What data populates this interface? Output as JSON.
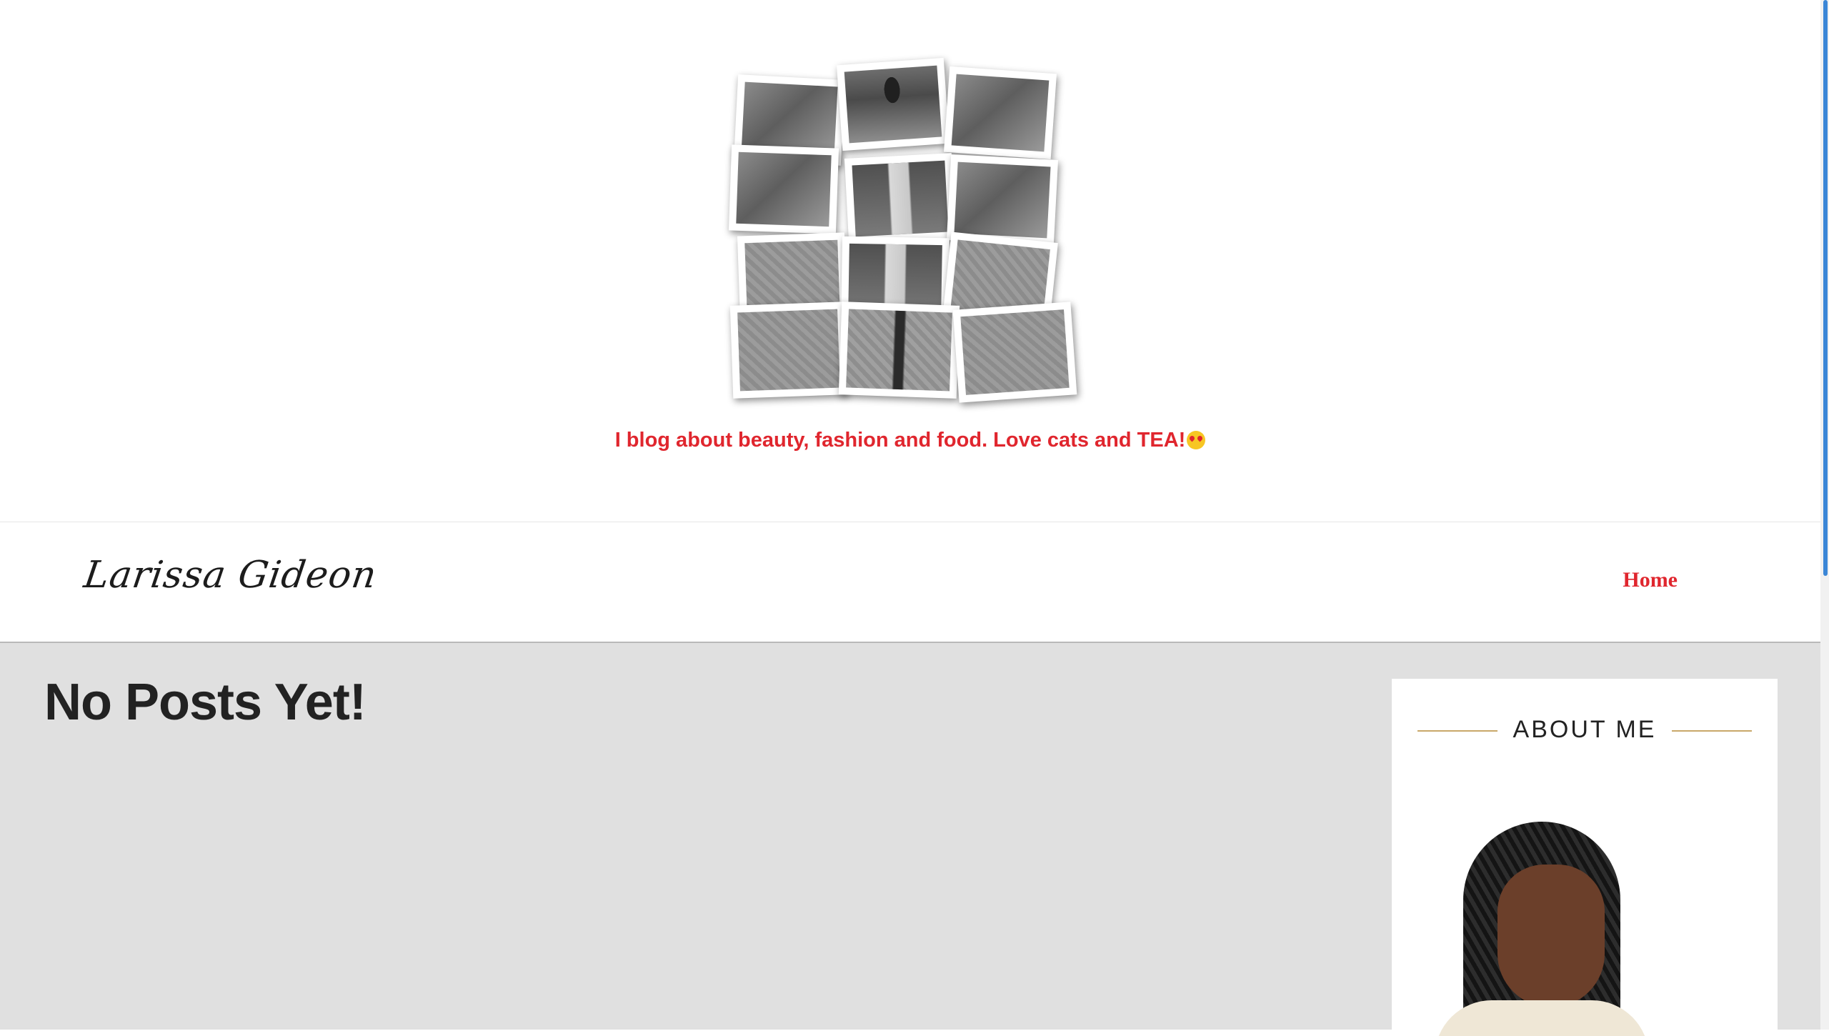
{
  "header": {
    "tagline": "I blog about beauty, fashion and food. Love cats and TEA!",
    "tagline_emoji_icon": "heart-eyes-emoji-icon"
  },
  "nav": {
    "brand": "Larissa Gideon",
    "items": [
      {
        "label": "Home",
        "active": true
      }
    ]
  },
  "main": {
    "title": "No Posts Yet!"
  },
  "sidebar": {
    "widget_title": "ABOUT ME"
  },
  "colors": {
    "accent": "#e0262e",
    "content_bg": "#e0e0e0",
    "divider_gold": "#c9a86a",
    "scrollbar": "#3b86d6"
  }
}
